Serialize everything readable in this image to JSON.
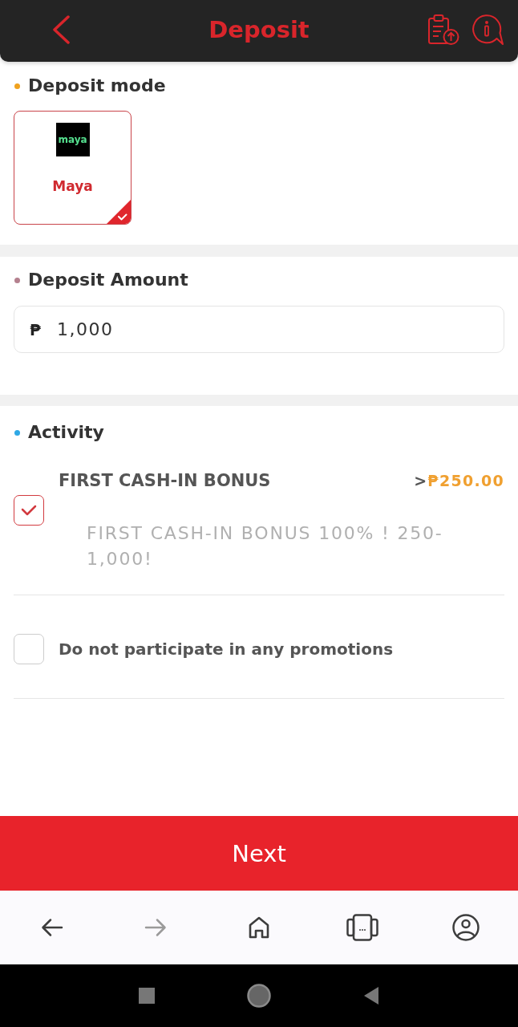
{
  "header": {
    "title": "Deposit"
  },
  "sections": [
    {
      "kind": "modes",
      "title": "Deposit mode",
      "color": "#f0a21e",
      "methods": [
        {
          "logo_text": "maya",
          "name": "Maya",
          "selected": true
        }
      ]
    },
    {
      "kind": "amount",
      "title": "Deposit Amount",
      "color": "#b4808e",
      "currency": "₱",
      "value": "1,000"
    },
    {
      "kind": "activity",
      "title": "Activity",
      "color": "#2ea8e5",
      "promotions": [
        {
          "kind": "bonus",
          "title": "FIRST CASH-IN BONUS",
          "amount_prefix": ">",
          "amount": "₱250.00",
          "description": "FIRST CASH-IN BONUS 100% ! 250-1,000!",
          "checked": true
        },
        {
          "kind": "opt_out",
          "label": "Do not participate in any promotions",
          "checked": false
        }
      ]
    }
  ],
  "submit": {
    "label": "Next"
  },
  "browser_toolbar": [
    {
      "kind": "back",
      "disabled": false
    },
    {
      "kind": "forward",
      "disabled": true
    },
    {
      "kind": "home",
      "disabled": false
    },
    {
      "kind": "tabs",
      "disabled": false
    },
    {
      "kind": "account",
      "disabled": false
    }
  ]
}
